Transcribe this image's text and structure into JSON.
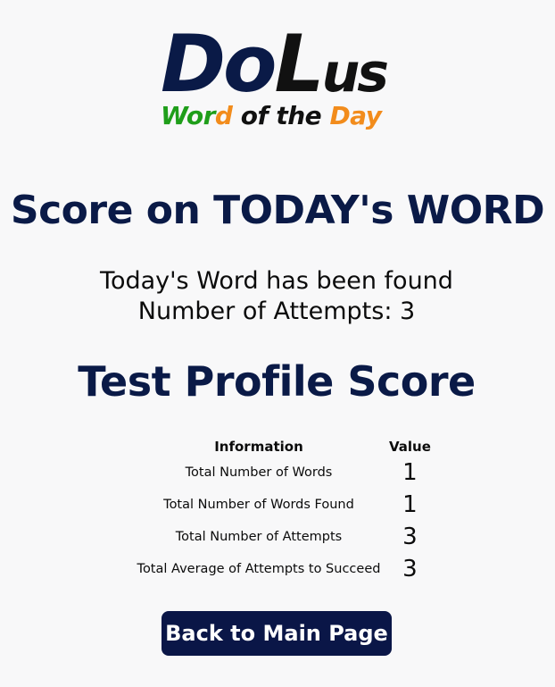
{
  "logo": {
    "title_part1": "Do",
    "title_part2": "L",
    "title_part3": "us",
    "subtitle_part1": "Wor",
    "subtitle_part2": "d",
    "subtitle_part3": " of the ",
    "subtitle_part4": "Day",
    "colors": {
      "navy": "#0a1a47",
      "black": "#111111",
      "green": "#1f9e1a",
      "orange": "#f28c1c"
    }
  },
  "today": {
    "heading": "Score on TODAY's WORD",
    "status_line": "Today's Word has been found",
    "attempts_line": "Number of Attempts: 3"
  },
  "profile": {
    "heading": "Test Profile Score",
    "table": {
      "headers": [
        "Information",
        "Value"
      ],
      "rows": [
        {
          "label": "Total Number of Words",
          "value": "1"
        },
        {
          "label": "Total Number of Words Found",
          "value": "1"
        },
        {
          "label": "Total Number of Attempts",
          "value": "3"
        },
        {
          "label": "Total Average of Attempts to Succeed",
          "value": "3"
        }
      ]
    }
  },
  "actions": {
    "back_label": "Back to Main Page"
  },
  "theme": {
    "background": "#f8f8f9",
    "heading_color": "#0a1a47",
    "button_bg": "#0a1647"
  }
}
